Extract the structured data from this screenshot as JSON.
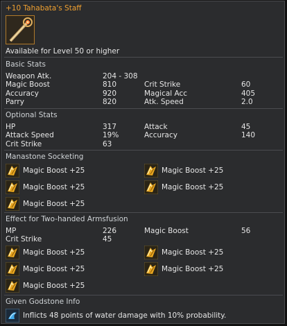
{
  "title": "+10 Tahabata's Staff",
  "available": "Available for Level 50 or higher",
  "basic": {
    "header": "Basic Stats",
    "rows": [
      [
        "Weapon Atk.",
        "204 - 308",
        "",
        ""
      ],
      [
        "Magic Boost",
        "810",
        "Crit Strike",
        "60"
      ],
      [
        "Accuracy",
        "920",
        "Magical Acc",
        "405"
      ],
      [
        "Parry",
        "820",
        "Atk. Speed",
        "2.0"
      ]
    ]
  },
  "optional": {
    "header": "Optional Stats",
    "rows": [
      [
        "HP",
        "317",
        "Attack",
        "45"
      ],
      [
        "Attack Speed",
        "19%",
        "Accuracy",
        "140"
      ],
      [
        "Crit Strike",
        "63",
        "",
        ""
      ]
    ]
  },
  "manastone": {
    "header": "Manastone Socketing",
    "items": [
      "Magic Boost +25",
      "Magic Boost +25",
      "Magic Boost +25",
      "Magic Boost +25",
      "Magic Boost +25"
    ]
  },
  "armsfusion": {
    "header": "Effect for Two-handed Armsfusion",
    "rows": [
      [
        "MP",
        "226",
        "Magic Boost",
        "56"
      ],
      [
        "Crit Strike",
        "45",
        "",
        ""
      ]
    ],
    "items": [
      "Magic Boost +25",
      "Magic Boost +25",
      "Magic Boost +25",
      "Magic Boost +25",
      "Magic Boost +25"
    ]
  },
  "godstone": {
    "header": "Given Godstone Info",
    "text": "Inflicts 48 points of water damage with 10% probability."
  },
  "icons": {
    "item": "staff-icon",
    "manastone": "manastone-icon",
    "godstone": "godstone-icon"
  },
  "colors": {
    "title": "#f0a030",
    "text": "#e6e6e6",
    "panel": "#2b2c2e"
  }
}
